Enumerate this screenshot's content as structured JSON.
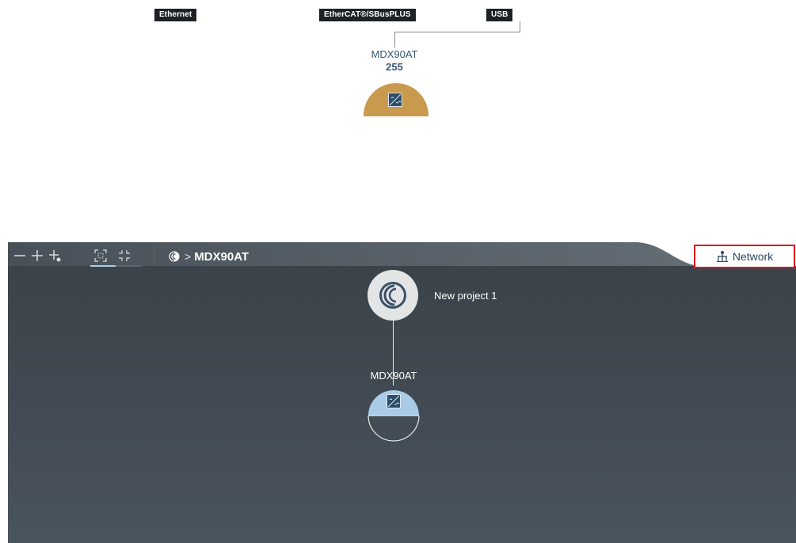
{
  "network_view": {
    "buses": [
      {
        "label": "Ethernet"
      },
      {
        "label": "EtherCAT®/SBusPLUS"
      },
      {
        "label": "USB"
      }
    ],
    "device": {
      "name": "MDX90AT",
      "address": "255",
      "icon": "drive-icon",
      "node_color": "#c99a4e"
    }
  },
  "toolbar": {
    "zoom_out_icon": "zoom-out-icon",
    "zoom_in_icon": "zoom-in-icon",
    "add_icon": "add-node-icon",
    "fit_icon": "expand-view-icon",
    "collapse_icon": "collapse-view-icon",
    "breadcrumb": {
      "separator": ">",
      "device": "MDX90AT"
    },
    "network_button": {
      "label": "Network",
      "icon": "network-icon"
    }
  },
  "project_tree": {
    "project_name": "New project 1",
    "device_name": "MDX90AT"
  },
  "colors": {
    "highlight_border": "#e3141e",
    "accent_blue": "#a9cbe8",
    "dark_pane": "#3d454d"
  }
}
